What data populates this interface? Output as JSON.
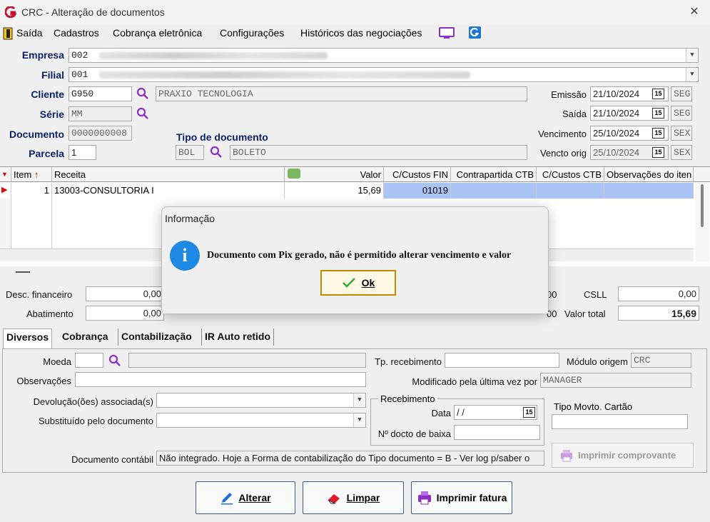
{
  "window": {
    "title": "CRC - Alteração de documentos",
    "close": "✕"
  },
  "menu": [
    "Saída",
    "Cadastros",
    "Cobrança eletrônica",
    "Configurações",
    "Históricos das negociações"
  ],
  "header": {
    "empresa_label": "Empresa",
    "empresa_code": "002",
    "filial_label": "Filial",
    "filial_code": "001",
    "cliente_label": "Cliente",
    "cliente_code": "G950",
    "cliente_name": "PRAXIO TECNOLOGIA",
    "serie_label": "Série",
    "serie_value": "MM",
    "documento_label": "Documento",
    "documento_value": "0000000008",
    "parcela_label": "Parcela",
    "parcela_value": "1",
    "tipo_doc_label": "Tipo de documento",
    "tipo_doc_code": "BOL",
    "tipo_doc_name": "BOLETO",
    "emissao_label": "Emissão",
    "emissao_date": "21/10/2024",
    "emissao_day": "SEG",
    "saida_label": "Saída",
    "saida_date": "21/10/2024",
    "saida_day": "SEG",
    "vencimento_label": "Vencimento",
    "vencimento_date": "25/10/2024",
    "vencimento_day": "SEX",
    "vencto_orig_label": "Vencto orig",
    "vencto_orig_date": "25/10/2024",
    "vencto_orig_day": "SEX",
    "cal_icon": "15"
  },
  "grid": {
    "columns": [
      "Item",
      "Receita",
      "Valor",
      "C/Custos FIN",
      "Contrapartida CTB",
      "C/Custos CTB",
      "Observações do iten"
    ],
    "rows": [
      {
        "item": "1",
        "receita": "13003-CONSULTORIA I",
        "valor": "15,69",
        "ccustos_fin": "01019"
      }
    ]
  },
  "totals": {
    "desc_financeiro_label": "Desc. financeiro",
    "desc_financeiro_value": "0,00",
    "abatimento_label": "Abatimento",
    "abatimento_value": "0,00",
    "partial_right_1": "00",
    "partial_right_2": "00",
    "csll_label": "CSLL",
    "csll_value": "0,00",
    "valor_total_label": "Valor total",
    "valor_total_value": "15,69"
  },
  "tabs": [
    "Diversos",
    "Cobrança",
    "Contabilização",
    "IR Auto retido"
  ],
  "diversos": {
    "moeda_label": "Moeda",
    "observacoes_label": "Observações",
    "devolucoes_label": "Devolução(ões) associada(s)",
    "substituido_label": "Substituído pelo documento",
    "tp_recebimento_label": "Tp. recebimento",
    "modulo_origem_label": "Módulo origem",
    "modulo_origem_value": "CRC",
    "modificado_label": "Modificado pela última vez por",
    "modificado_value": "MANAGER",
    "recebimento_group": "Recebimento",
    "data_label": "Data",
    "data_value": "/ /",
    "ndocto_label": "Nº docto de baixa",
    "tipo_movto_label": "Tipo Movto. Cartão",
    "doc_contabil_label": "Documento contábil",
    "doc_contabil_value": "Não integrado. Hoje a Forma de contabilização do Tipo documento = B - Ver log p/saber o",
    "imprimir_comprovante": "Imprimir comprovante"
  },
  "buttons": {
    "alterar": "Alterar",
    "limpar": "Limpar",
    "imprimir_fatura": "Imprimir fatura"
  },
  "dialog": {
    "title": "Informação",
    "message": "Documento com Pix gerado, não é permitido alterar vencimento e valor",
    "ok": "Ok"
  },
  "colors": {
    "label_blue": "#0a1f6b",
    "accent_purple": "#8b2fc9",
    "selection": "#a9c4f5"
  }
}
